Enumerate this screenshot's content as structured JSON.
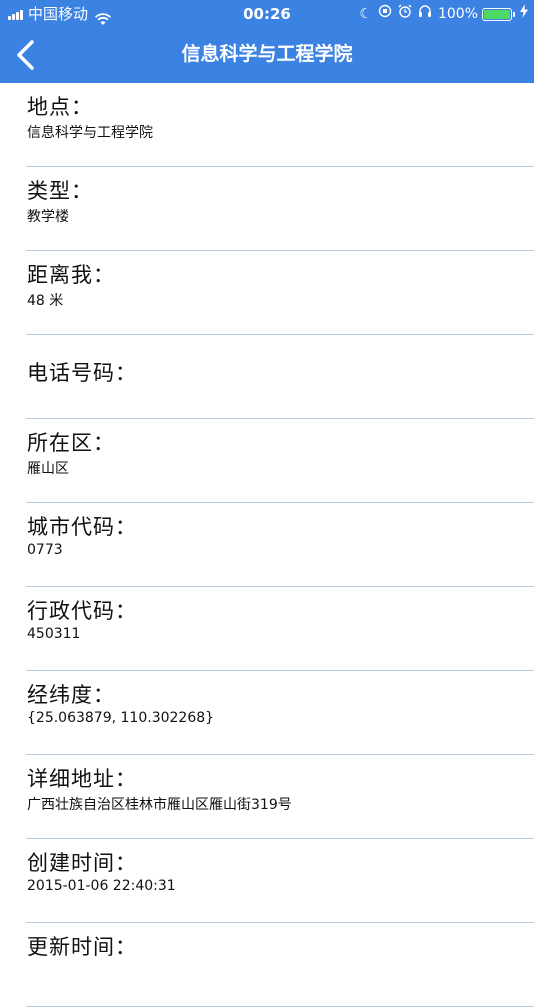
{
  "status_bar": {
    "carrier": "中国移动",
    "time": "00:26",
    "battery_percent": "100%",
    "icons": [
      "signal-icon",
      "wifi-icon",
      "moon-icon",
      "rotation-lock-icon",
      "alarm-icon",
      "headphones-icon",
      "battery-icon",
      "charging-icon"
    ]
  },
  "nav": {
    "title": "信息科学与工程学院",
    "back_icon": "chevron-left-icon"
  },
  "fields": [
    {
      "label": "地点：",
      "value": "信息科学与工程学院"
    },
    {
      "label": "类型：",
      "value": "教学楼"
    },
    {
      "label": "距离我：",
      "value": "48 米"
    },
    {
      "label": "电话号码：",
      "value": ""
    },
    {
      "label": "所在区：",
      "value": "雁山区"
    },
    {
      "label": "城市代码：",
      "value": "0773"
    },
    {
      "label": "行政代码：",
      "value": "450311"
    },
    {
      "label": "经纬度：",
      "value": "{25.063879, 110.302268}"
    },
    {
      "label": "详细地址：",
      "value": "广西壮族自治区桂林市雁山区雁山街319号"
    },
    {
      "label": "创建时间：",
      "value": "2015-01-06 22:40:31"
    },
    {
      "label": "更新时间：",
      "value": ""
    }
  ],
  "colors": {
    "header_bg": "#3b82e3",
    "divider": "#b7cbe6",
    "battery_fill": "#4cd964"
  }
}
